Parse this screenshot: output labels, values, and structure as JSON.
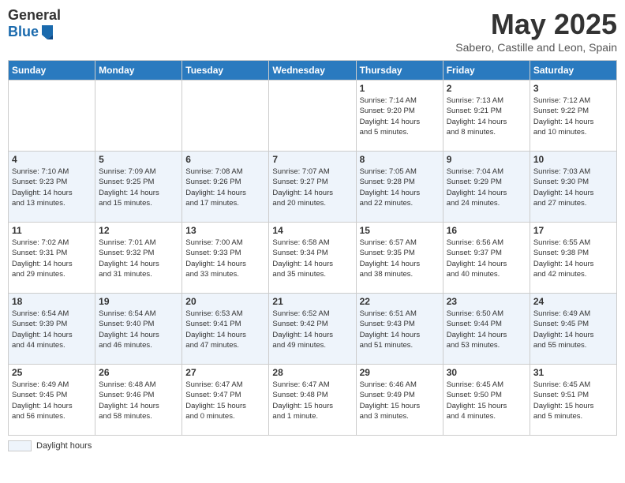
{
  "logo": {
    "general": "General",
    "blue": "Blue"
  },
  "title": "May 2025",
  "subtitle": "Sabero, Castille and Leon, Spain",
  "days_of_week": [
    "Sunday",
    "Monday",
    "Tuesday",
    "Wednesday",
    "Thursday",
    "Friday",
    "Saturday"
  ],
  "weeks": [
    [
      {
        "day": "",
        "info": ""
      },
      {
        "day": "",
        "info": ""
      },
      {
        "day": "",
        "info": ""
      },
      {
        "day": "",
        "info": ""
      },
      {
        "day": "1",
        "info": "Sunrise: 7:14 AM\nSunset: 9:20 PM\nDaylight: 14 hours\nand 5 minutes."
      },
      {
        "day": "2",
        "info": "Sunrise: 7:13 AM\nSunset: 9:21 PM\nDaylight: 14 hours\nand 8 minutes."
      },
      {
        "day": "3",
        "info": "Sunrise: 7:12 AM\nSunset: 9:22 PM\nDaylight: 14 hours\nand 10 minutes."
      }
    ],
    [
      {
        "day": "4",
        "info": "Sunrise: 7:10 AM\nSunset: 9:23 PM\nDaylight: 14 hours\nand 13 minutes."
      },
      {
        "day": "5",
        "info": "Sunrise: 7:09 AM\nSunset: 9:25 PM\nDaylight: 14 hours\nand 15 minutes."
      },
      {
        "day": "6",
        "info": "Sunrise: 7:08 AM\nSunset: 9:26 PM\nDaylight: 14 hours\nand 17 minutes."
      },
      {
        "day": "7",
        "info": "Sunrise: 7:07 AM\nSunset: 9:27 PM\nDaylight: 14 hours\nand 20 minutes."
      },
      {
        "day": "8",
        "info": "Sunrise: 7:05 AM\nSunset: 9:28 PM\nDaylight: 14 hours\nand 22 minutes."
      },
      {
        "day": "9",
        "info": "Sunrise: 7:04 AM\nSunset: 9:29 PM\nDaylight: 14 hours\nand 24 minutes."
      },
      {
        "day": "10",
        "info": "Sunrise: 7:03 AM\nSunset: 9:30 PM\nDaylight: 14 hours\nand 27 minutes."
      }
    ],
    [
      {
        "day": "11",
        "info": "Sunrise: 7:02 AM\nSunset: 9:31 PM\nDaylight: 14 hours\nand 29 minutes."
      },
      {
        "day": "12",
        "info": "Sunrise: 7:01 AM\nSunset: 9:32 PM\nDaylight: 14 hours\nand 31 minutes."
      },
      {
        "day": "13",
        "info": "Sunrise: 7:00 AM\nSunset: 9:33 PM\nDaylight: 14 hours\nand 33 minutes."
      },
      {
        "day": "14",
        "info": "Sunrise: 6:58 AM\nSunset: 9:34 PM\nDaylight: 14 hours\nand 35 minutes."
      },
      {
        "day": "15",
        "info": "Sunrise: 6:57 AM\nSunset: 9:35 PM\nDaylight: 14 hours\nand 38 minutes."
      },
      {
        "day": "16",
        "info": "Sunrise: 6:56 AM\nSunset: 9:37 PM\nDaylight: 14 hours\nand 40 minutes."
      },
      {
        "day": "17",
        "info": "Sunrise: 6:55 AM\nSunset: 9:38 PM\nDaylight: 14 hours\nand 42 minutes."
      }
    ],
    [
      {
        "day": "18",
        "info": "Sunrise: 6:54 AM\nSunset: 9:39 PM\nDaylight: 14 hours\nand 44 minutes."
      },
      {
        "day": "19",
        "info": "Sunrise: 6:54 AM\nSunset: 9:40 PM\nDaylight: 14 hours\nand 46 minutes."
      },
      {
        "day": "20",
        "info": "Sunrise: 6:53 AM\nSunset: 9:41 PM\nDaylight: 14 hours\nand 47 minutes."
      },
      {
        "day": "21",
        "info": "Sunrise: 6:52 AM\nSunset: 9:42 PM\nDaylight: 14 hours\nand 49 minutes."
      },
      {
        "day": "22",
        "info": "Sunrise: 6:51 AM\nSunset: 9:43 PM\nDaylight: 14 hours\nand 51 minutes."
      },
      {
        "day": "23",
        "info": "Sunrise: 6:50 AM\nSunset: 9:44 PM\nDaylight: 14 hours\nand 53 minutes."
      },
      {
        "day": "24",
        "info": "Sunrise: 6:49 AM\nSunset: 9:45 PM\nDaylight: 14 hours\nand 55 minutes."
      }
    ],
    [
      {
        "day": "25",
        "info": "Sunrise: 6:49 AM\nSunset: 9:45 PM\nDaylight: 14 hours\nand 56 minutes."
      },
      {
        "day": "26",
        "info": "Sunrise: 6:48 AM\nSunset: 9:46 PM\nDaylight: 14 hours\nand 58 minutes."
      },
      {
        "day": "27",
        "info": "Sunrise: 6:47 AM\nSunset: 9:47 PM\nDaylight: 15 hours\nand 0 minutes."
      },
      {
        "day": "28",
        "info": "Sunrise: 6:47 AM\nSunset: 9:48 PM\nDaylight: 15 hours\nand 1 minute."
      },
      {
        "day": "29",
        "info": "Sunrise: 6:46 AM\nSunset: 9:49 PM\nDaylight: 15 hours\nand 3 minutes."
      },
      {
        "day": "30",
        "info": "Sunrise: 6:45 AM\nSunset: 9:50 PM\nDaylight: 15 hours\nand 4 minutes."
      },
      {
        "day": "31",
        "info": "Sunrise: 6:45 AM\nSunset: 9:51 PM\nDaylight: 15 hours\nand 5 minutes."
      }
    ]
  ],
  "legend_label": "Daylight hours"
}
